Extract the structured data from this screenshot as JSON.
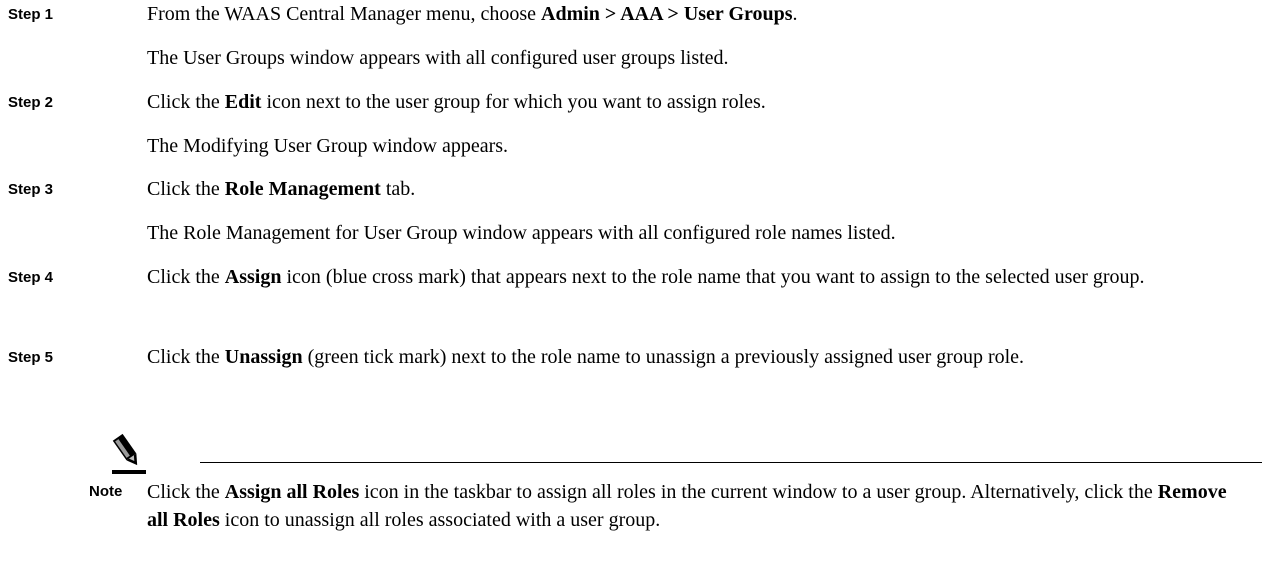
{
  "steps": [
    {
      "label": "Step 1",
      "lines": [
        {
          "pre": "From the WAAS Central Manager menu, choose ",
          "bold": "Admin > AAA > User Groups",
          "post": "."
        },
        {
          "pre": "The User Groups window appears with all configured user groups listed.",
          "bold": "",
          "post": ""
        }
      ]
    },
    {
      "label": "Step 2",
      "lines": [
        {
          "pre": "Click the ",
          "bold": "Edit",
          "post": " icon next to the user group for which you want to assign roles."
        },
        {
          "pre": "The Modifying User Group window appears.",
          "bold": "",
          "post": ""
        }
      ]
    },
    {
      "label": "Step 3",
      "lines": [
        {
          "pre": "Click the ",
          "bold": "Role Management",
          "post": " tab."
        },
        {
          "pre": "The Role Management for User Group window appears with all configured role names listed.",
          "bold": "",
          "post": ""
        }
      ]
    },
    {
      "label": "Step 4",
      "lines": [
        {
          "pre": "Click the ",
          "bold": "Assign",
          "post": " icon (blue cross mark) that appears next to the role name that you want to assign to the selected user group."
        }
      ]
    },
    {
      "label": "Step 5",
      "lines": [
        {
          "pre": "Click the ",
          "bold": "Unassign",
          "post": " (green tick mark) next to the role name to unassign a previously assigned user group role."
        }
      ]
    }
  ],
  "note": {
    "label": "Note",
    "icon": "pencil-note-icon",
    "pre": "Click the ",
    "bold1": "Assign all Roles",
    "mid": " icon in the taskbar to assign all roles in the current window to a user group. Alternatively, click the ",
    "bold2": "Remove all Roles",
    "post": " icon to unassign all roles associated with a user group."
  }
}
